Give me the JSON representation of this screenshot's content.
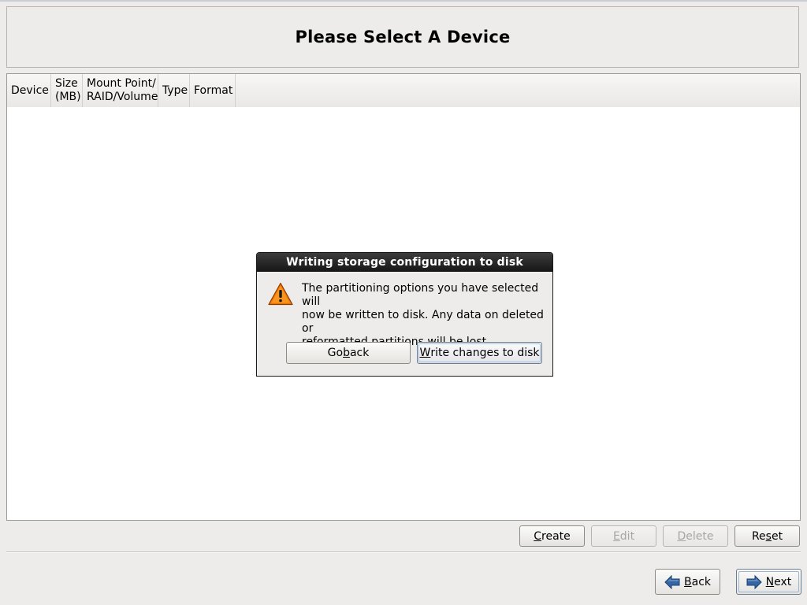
{
  "header": {
    "title": "Please Select A Device"
  },
  "table": {
    "columns": [
      {
        "label": "Device"
      },
      {
        "label": "Size\n(MB)"
      },
      {
        "label": "Mount Point/\nRAID/Volume"
      },
      {
        "label": "Type"
      },
      {
        "label": "Format"
      }
    ],
    "rows": []
  },
  "actions": {
    "create": {
      "pre": "",
      "key": "C",
      "post": "reate",
      "enabled": true
    },
    "edit": {
      "pre": "",
      "key": "E",
      "post": "dit",
      "enabled": false
    },
    "delete": {
      "pre": "",
      "key": "D",
      "post": "elete",
      "enabled": false
    },
    "reset": {
      "pre": "Re",
      "key": "s",
      "post": "et",
      "enabled": true
    }
  },
  "nav": {
    "back": {
      "pre": "",
      "key": "B",
      "post": "ack",
      "icon": "back-arrow-icon"
    },
    "next": {
      "pre": "",
      "key": "N",
      "post": "ext",
      "icon": "next-arrow-icon"
    }
  },
  "dialog": {
    "title": "Writing storage configuration to disk",
    "icon": "warning-icon",
    "message": "The partitioning options you have selected will\nnow be written to disk.  Any data on deleted or\nreformatted partitions will be lost.",
    "go_back": {
      "pre": "Go ",
      "key": "b",
      "post": "ack"
    },
    "write": {
      "pre": "",
      "key": "W",
      "post": "rite changes to disk"
    }
  },
  "colors": {
    "background": "#edeceb",
    "warning_fill": "#f57900",
    "arrow_fill": "#3465a4"
  }
}
